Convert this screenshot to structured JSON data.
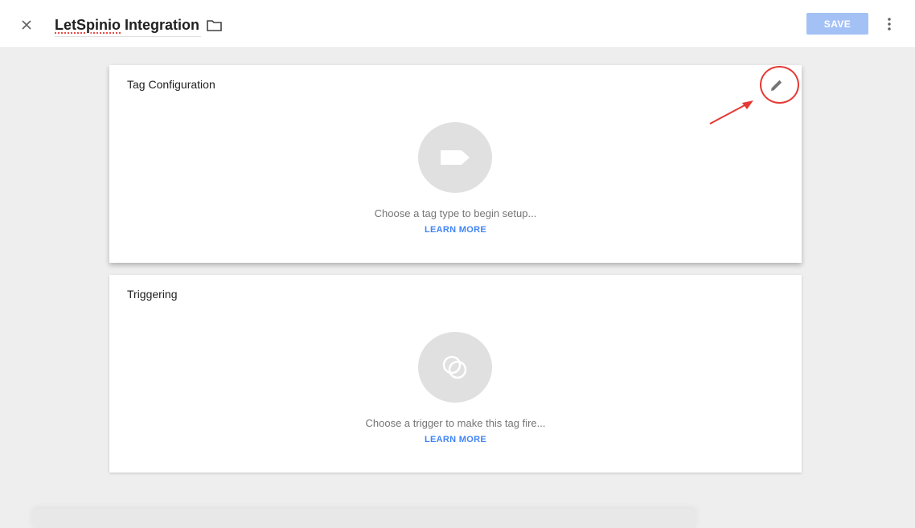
{
  "header": {
    "title_underlined": "LetSpinio",
    "title_rest": " Integration",
    "save_label": "SAVE",
    "close_icon": "close-icon",
    "folder_icon": "folder-icon",
    "more_icon": "more-vert-icon"
  },
  "tag_config": {
    "title": "Tag Configuration",
    "placeholder_text": "Choose a tag type to begin setup...",
    "learn_more": "LEARN MORE",
    "edit_icon": "pencil-icon",
    "placeholder_icon": "tag-icon"
  },
  "triggering": {
    "title": "Triggering",
    "placeholder_text": "Choose a trigger to make this tag fire...",
    "learn_more": "LEARN MORE",
    "placeholder_icon": "trigger-icon"
  },
  "colors": {
    "accent": "#4285f4",
    "save_disabled": "#a4c1f6",
    "annotation": "#e53935"
  }
}
